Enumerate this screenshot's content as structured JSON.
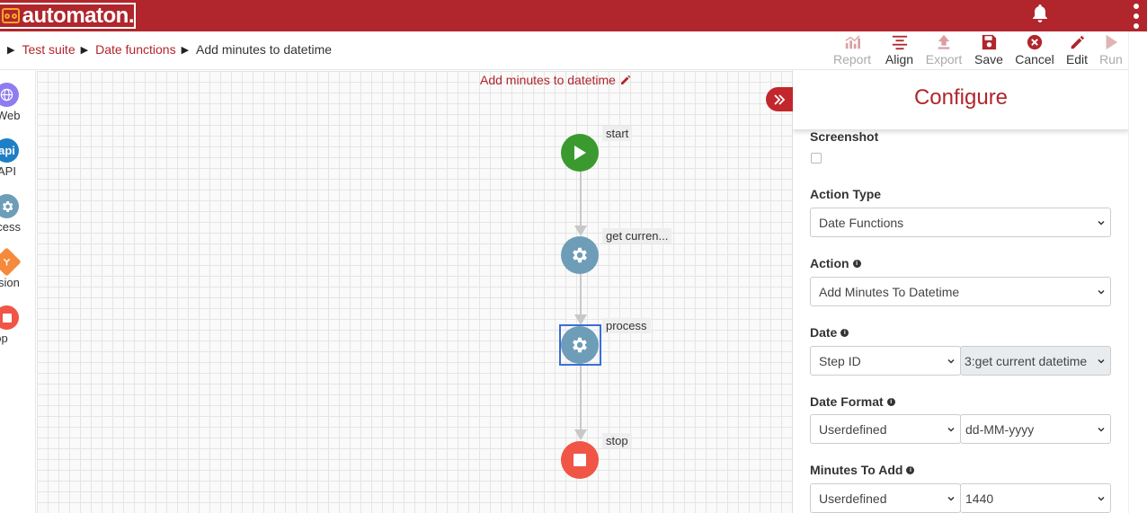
{
  "app": {
    "logo_text": "automaton."
  },
  "breadcrumb": {
    "separator": "▶",
    "items": [
      "Test suite",
      "Date functions"
    ],
    "current": "Add minutes to datetime"
  },
  "toolbar": {
    "report": "Report",
    "align": "Align",
    "export": "Export",
    "save": "Save",
    "cancel": "Cancel",
    "edit": "Edit",
    "run": "Run"
  },
  "palette": {
    "web": {
      "label": "Web",
      "color": "#8e7cf0"
    },
    "api": {
      "label": "API",
      "icon_text": "api",
      "color": "#1e7fc6"
    },
    "process": {
      "label": "Process",
      "color": "#6e9db8"
    },
    "decision": {
      "label": "Decision",
      "color": "#f58a3c"
    },
    "stop": {
      "label": "Stop",
      "color": "#f05545"
    }
  },
  "flow": {
    "title": "Add minutes to datetime",
    "nodes": [
      {
        "label": "start",
        "kind": "start",
        "color": "#3a9a2f"
      },
      {
        "label": "get curren...",
        "kind": "process",
        "color": "#6e9db8"
      },
      {
        "label": "process",
        "kind": "process",
        "color": "#6e9db8",
        "selected": true
      },
      {
        "label": "stop",
        "kind": "stop",
        "color": "#f05545"
      }
    ]
  },
  "configure": {
    "title": "Configure",
    "screenshot": {
      "label": "Screenshot",
      "checked": false
    },
    "action_type": {
      "label": "Action Type",
      "value": "Date Functions"
    },
    "action": {
      "label": "Action",
      "value": "Add Minutes To Datetime"
    },
    "date": {
      "label": "Date",
      "source": "Step ID",
      "value": "3:get current datetime"
    },
    "date_format": {
      "label": "Date Format",
      "source": "Userdefined",
      "value": "dd-MM-yyyy"
    },
    "minutes_to_add": {
      "label": "Minutes To Add",
      "source": "Userdefined",
      "value": "1440"
    }
  },
  "colors": {
    "brand": "#b0262c",
    "selection": "#3b6fd4"
  }
}
